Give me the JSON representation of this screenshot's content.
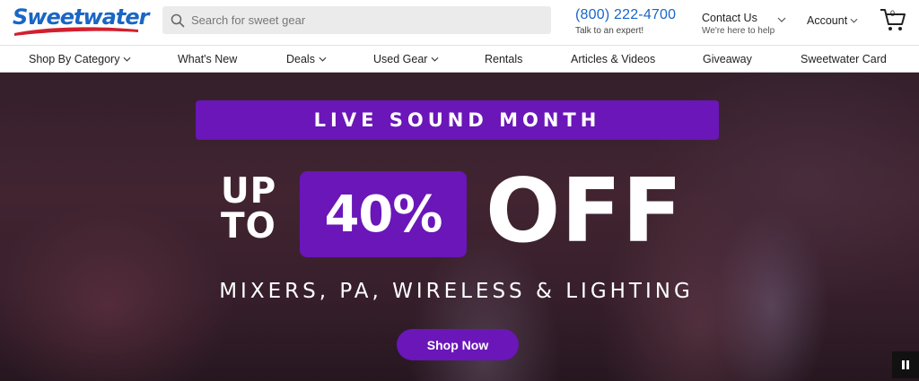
{
  "header": {
    "logo_text": "Sweetwater",
    "search_placeholder": "Search for sweet gear",
    "phone": "(800) 222-4700",
    "phone_sub": "Talk to an expert!",
    "contact_label": "Contact Us",
    "contact_sub": "We're here to help",
    "account_label": "Account",
    "cart_count": "0"
  },
  "nav": {
    "items": [
      {
        "label": "Shop By Category",
        "has_dropdown": true
      },
      {
        "label": "What's New",
        "has_dropdown": false
      },
      {
        "label": "Deals",
        "has_dropdown": true
      },
      {
        "label": "Used Gear",
        "has_dropdown": true
      },
      {
        "label": "Rentals",
        "has_dropdown": false
      },
      {
        "label": "Articles & Videos",
        "has_dropdown": false
      },
      {
        "label": "Giveaway",
        "has_dropdown": false
      },
      {
        "label": "Sweetwater Card",
        "has_dropdown": false
      }
    ]
  },
  "hero": {
    "banner": "LIVE SOUND MONTH",
    "up": "UP",
    "to": "TO",
    "percent": "40%",
    "off": "OFF",
    "subline": "MIXERS, PA, WIRELESS & LIGHTING",
    "cta": "Shop Now"
  },
  "colors": {
    "brand_blue": "#1a66c5",
    "promo_purple": "#6a16b8",
    "logo_red": "#d1202f"
  }
}
